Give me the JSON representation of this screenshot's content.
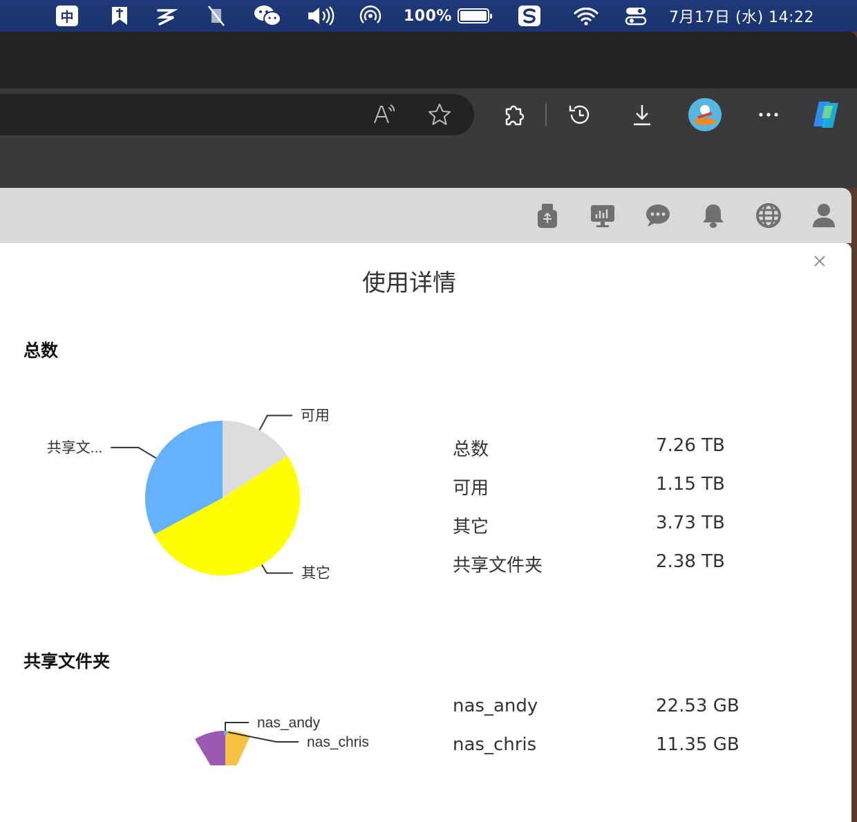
{
  "menubar": {
    "ime_label": "中",
    "battery_percent": "100%",
    "datetime": "7月17日 (水)  14:22",
    "icons": [
      "ime-icon",
      "bookmark-app-icon",
      "script-app-icon",
      "mute-bell-icon",
      "wechat-icon",
      "volume-icon",
      "airdrop-icon",
      "battery-icon",
      "sogou-icon",
      "wifi-icon",
      "control-center-icon"
    ]
  },
  "browser": {
    "toolbar_icons": [
      "read-aloud-icon",
      "favorite-star-icon",
      "extensions-icon",
      "history-icon",
      "download-icon",
      "profile-avatar-icon",
      "more-menu-icon",
      "copilot-icon"
    ]
  },
  "page_header": {
    "icons": [
      "usb-icon",
      "monitor-icon",
      "chat-icon",
      "bell-icon",
      "globe-icon",
      "user-icon"
    ]
  },
  "modal": {
    "title": "使用详情",
    "close_label": "×",
    "sections": [
      {
        "title": "总数",
        "rows": [
          {
            "label": "总数",
            "value": "7.26 TB"
          },
          {
            "label": "可用",
            "value": "1.15 TB"
          },
          {
            "label": "其它",
            "value": "3.73 TB"
          },
          {
            "label": "共享文件夹",
            "value": "2.38 TB"
          }
        ]
      },
      {
        "title": "共享文件夹",
        "rows": [
          {
            "label": "nas_andy",
            "value": "22.53 GB"
          },
          {
            "label": "nas_chris",
            "value": "11.35 GB"
          }
        ]
      }
    ]
  },
  "chart_data": [
    {
      "type": "pie",
      "categories": [
        "可用",
        "其它",
        "共享文..."
      ],
      "values": [
        1.15,
        3.73,
        2.38
      ],
      "colors": [
        "#dcdcdc",
        "#ffff00",
        "#66b1ff"
      ]
    },
    {
      "type": "pie",
      "categories": [
        "nas_andy",
        "nas_chris"
      ],
      "values": [
        22.53,
        11.35
      ],
      "colors": [
        "#66b1ff",
        "#f5c242"
      ]
    }
  ]
}
